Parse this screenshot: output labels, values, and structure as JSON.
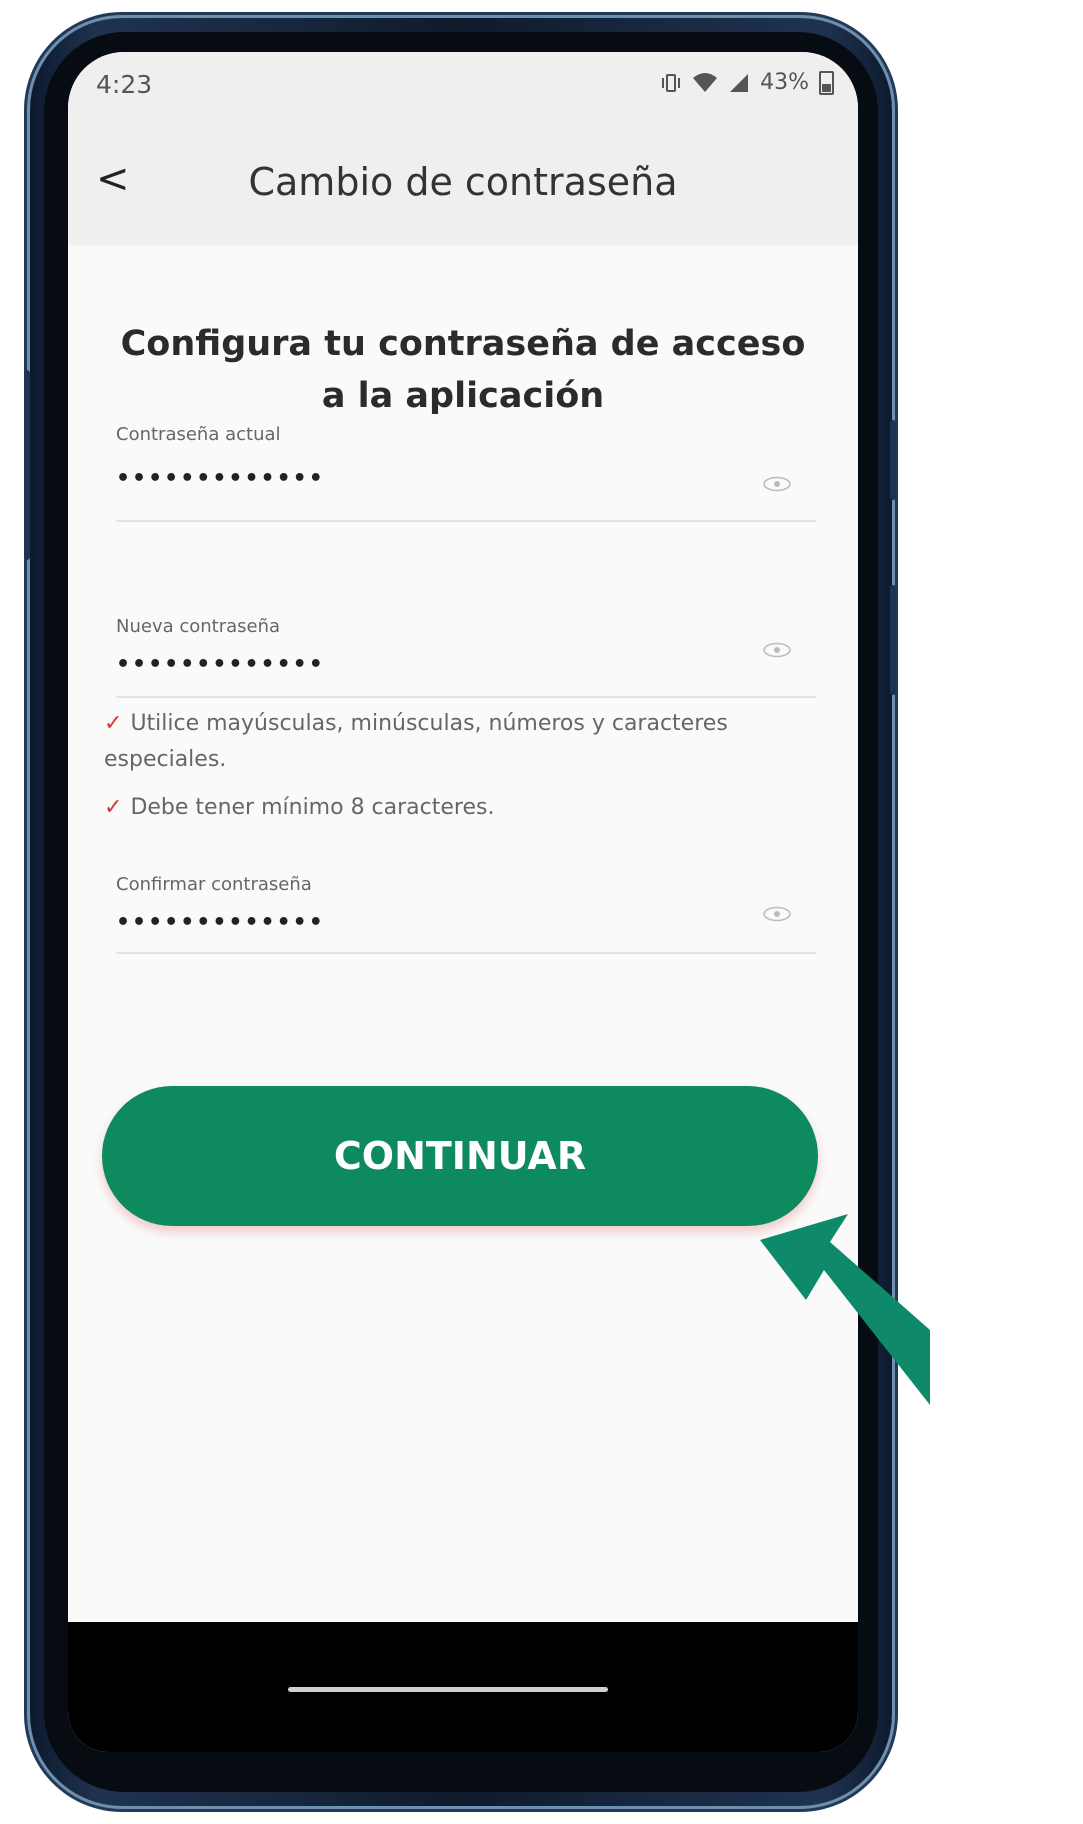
{
  "status_bar": {
    "time": "4:23",
    "battery": "43%"
  },
  "header": {
    "back_icon": "<",
    "title": "Cambio de contraseña"
  },
  "main": {
    "heading": "Configura tu contraseña de acceso a la aplicación",
    "fields": [
      {
        "label": "Contraseña actual",
        "value": "•••••••••••••"
      },
      {
        "label": "Nueva contraseña",
        "value": "•••••••••••••"
      },
      {
        "label": "Confirmar contraseña",
        "value": "•••••••••••••"
      }
    ],
    "rules": [
      "Utilice mayúsculas, minúsculas, números y caracteres especiales.",
      "Debe tener mínimo 8 caracteres."
    ],
    "continue_label": "CONTINUAR"
  },
  "colors": {
    "accent": "#0e8a5f",
    "check": "#dd3333",
    "frame": "#1f3350"
  }
}
